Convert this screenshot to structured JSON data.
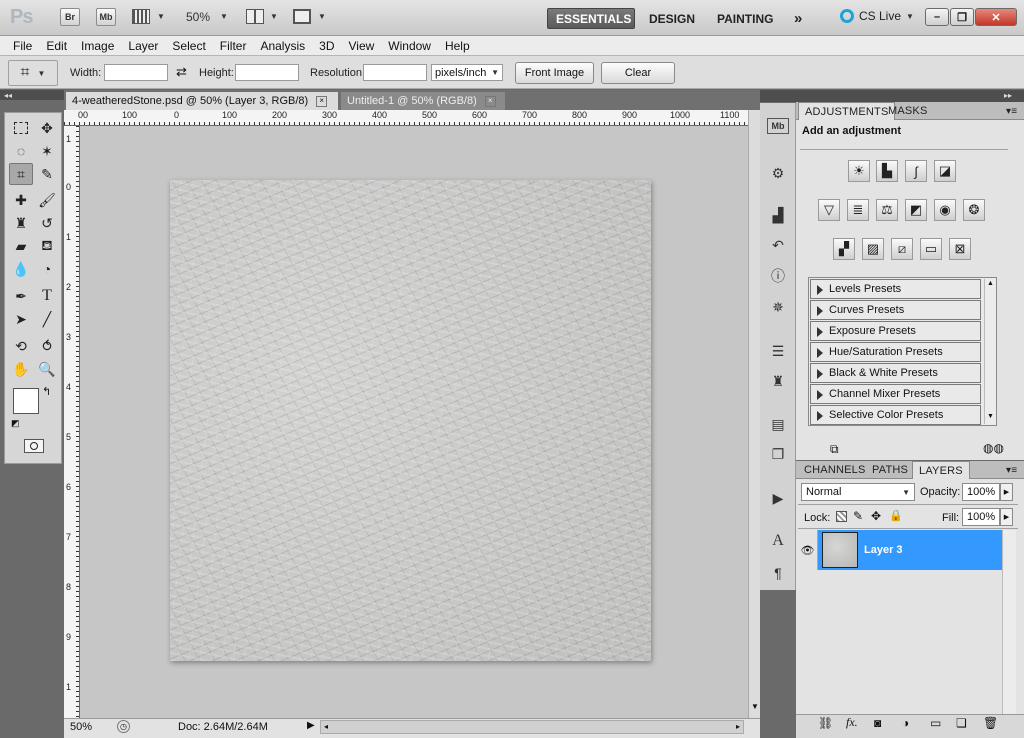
{
  "app": {
    "logo": "Ps",
    "bridge_label": "Br",
    "minibridge_label": "Mb",
    "zoom": "50%",
    "workspaces": [
      "ESSENTIALS",
      "DESIGN",
      "PAINTING"
    ],
    "more_workspaces": "»",
    "cs_live": "CS Live",
    "accent_color": "#3399ff"
  },
  "menu": [
    "File",
    "Edit",
    "Image",
    "Layer",
    "Select",
    "Filter",
    "Analysis",
    "3D",
    "View",
    "Window",
    "Help"
  ],
  "options": {
    "width_label": "Width:",
    "width_value": "",
    "height_label": "Height:",
    "height_value": "",
    "resolution_label": "Resolution:",
    "resolution_value": "",
    "resolution_unit": "pixels/inch",
    "front_image_label": "Front Image",
    "clear_label": "Clear"
  },
  "tabs": [
    {
      "label": "4-weatheredStone.psd @ 50% (Layer 3, RGB/8)",
      "close": "×"
    },
    {
      "label": "Untitled-1 @ 50% (RGB/8)",
      "close": "×"
    }
  ],
  "ruler_h": [
    "00",
    "100",
    "0",
    "100",
    "200",
    "300",
    "400",
    "500",
    "600",
    "700",
    "800",
    "900",
    "1000",
    "1100"
  ],
  "ruler_v": [
    "1",
    "0",
    "1",
    "2",
    "3",
    "4",
    "5",
    "6",
    "7",
    "8",
    "9",
    "1"
  ],
  "status": {
    "zoom": "50%",
    "doc": "Doc: 2.64M/2.64M"
  },
  "adjustments": {
    "tab_adjustments": "ADJUSTMENTS",
    "tab_masks": "MASKS",
    "heading": "Add an adjustment",
    "presets": [
      "Levels Presets",
      "Curves Presets",
      "Exposure Presets",
      "Hue/Saturation Presets",
      "Black & White Presets",
      "Channel Mixer Presets",
      "Selective Color Presets"
    ]
  },
  "layers": {
    "tab_channels": "CHANNELS",
    "tab_paths": "PATHS",
    "tab_layers": "LAYERS",
    "blend_mode": "Normal",
    "opacity_label": "Opacity:",
    "opacity_value": "100%",
    "lock_label": "Lock:",
    "fill_label": "Fill:",
    "fill_value": "100%",
    "layer_name": "Layer 3"
  }
}
